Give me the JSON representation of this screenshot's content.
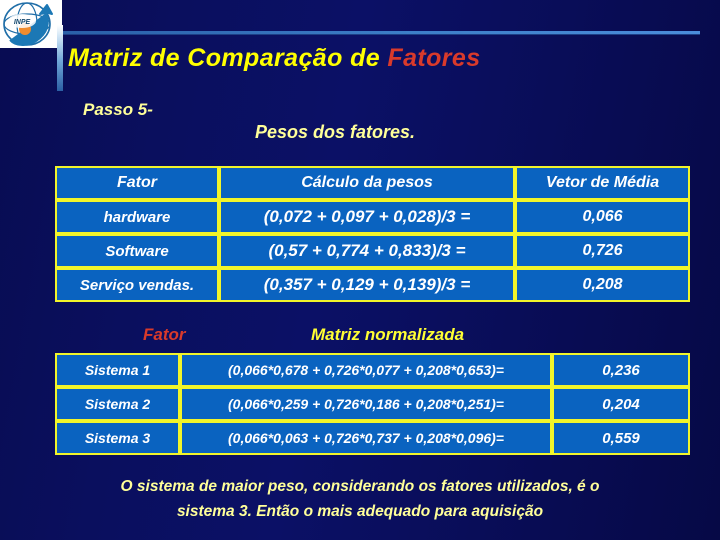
{
  "slide": {
    "logo_alt": "inpe-logo",
    "title_main": "Matriz de Comparação de ",
    "title_accent": "Fatores",
    "step_label": "Passo 5-",
    "section_subtitle": "Pesos dos fatores.",
    "footer_line1": "O sistema de maior peso, considerando os fatores utilizados, é o",
    "footer_line2": "sistema 3. Então o mais adequado para aquisição"
  },
  "colors": {
    "background": "#0a0f5e",
    "title_yellow": "#ffff00",
    "title_red": "#d93a2b",
    "cell_blue": "#0a63c0",
    "border_yellow": "#f2f52a",
    "subtitle_yellow": "#ffff99",
    "value_tan": "#c9863a",
    "value_red": "#d93a2b"
  },
  "table_pesos": {
    "headers": [
      "Fator",
      "Cálculo da pesos",
      "Vetor de Média"
    ],
    "rows": [
      {
        "fator": "hardware",
        "calculo": "(0,072 + 0,097 + 0,028)/3 =",
        "vetor": "0,066"
      },
      {
        "fator": "Software",
        "calculo": "(0,57 + 0,774 + 0,833)/3 =",
        "vetor": "0,726"
      },
      {
        "fator": "Serviço vendas.",
        "calculo": "(0,357 + 0,129 + 0,139)/3 =",
        "vetor": "0,208"
      }
    ]
  },
  "table_normalizada": {
    "label_fator": "Fator",
    "label_matriz": "Matriz normalizada",
    "rows": [
      {
        "sistema": "Sistema 1",
        "calculo": "(0,066*0,678 + 0,726*0,077 + 0,208*0,653)=",
        "resultado": "0,236"
      },
      {
        "sistema": "Sistema 2",
        "calculo": "(0,066*0,259 + 0,726*0,186 + 0,208*0,251)=",
        "resultado": "0,204"
      },
      {
        "sistema": "Sistema 3",
        "calculo": "(0,066*0,063 + 0,726*0,737 + 0,208*0,096)=",
        "resultado": "0,559"
      }
    ]
  }
}
